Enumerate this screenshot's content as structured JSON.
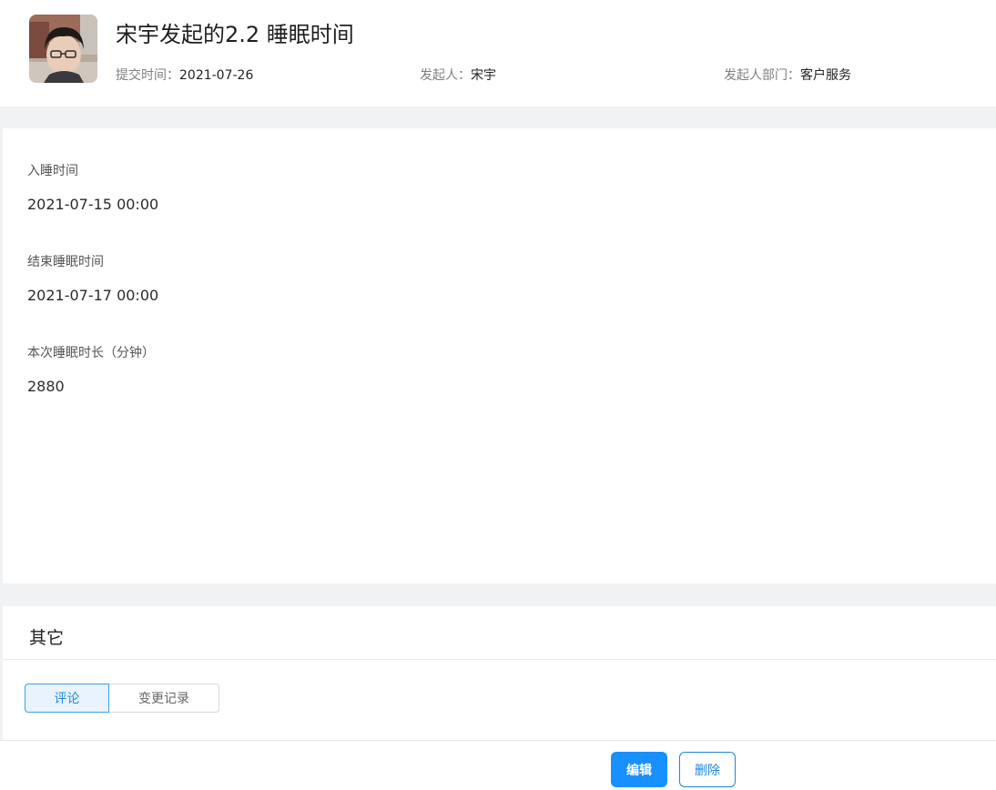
{
  "header": {
    "title": "宋宇发起的2.2 睡眠时间",
    "submit_time_label": "提交时间：",
    "submit_time_value": "2021-07-26",
    "initiator_label": "发起人：",
    "initiator_value": "宋宇",
    "department_label": "发起人部门：",
    "department_value": "客户服务"
  },
  "form": {
    "fields": [
      {
        "label": "入睡时间",
        "value": "2021-07-15 00:00"
      },
      {
        "label": "结束睡眠时间",
        "value": "2021-07-17 00:00"
      },
      {
        "label": "本次睡眠时长（分钟）",
        "value": "2880"
      }
    ]
  },
  "other": {
    "title": "其它",
    "tabs": [
      {
        "label": "评论",
        "active": true
      },
      {
        "label": "变更记录",
        "active": false
      }
    ]
  },
  "footer": {
    "edit_label": "编辑",
    "delete_label": "删除"
  },
  "colors": {
    "accent": "#1890ff",
    "band": "#f1f2f4"
  }
}
